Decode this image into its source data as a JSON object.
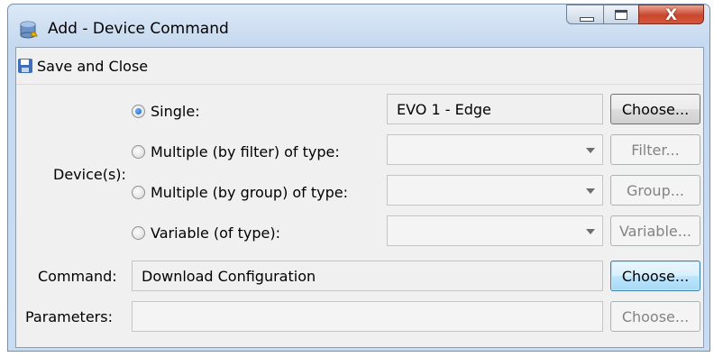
{
  "window": {
    "title": "Add - Device Command",
    "close_glyph": "X"
  },
  "toolbar": {
    "save_close_label": "Save and Close"
  },
  "devices": {
    "label": "Device(s):",
    "single": {
      "label": "Single:",
      "value": "EVO 1 - Edge",
      "button": "Choose..."
    },
    "filter": {
      "label": "Multiple (by filter) of type:",
      "value": "",
      "button": "Filter..."
    },
    "group": {
      "label": "Multiple (by group) of type:",
      "value": "",
      "button": "Group..."
    },
    "variable": {
      "label": "Variable (of type):",
      "value": "",
      "button": "Variable..."
    },
    "selected": "single"
  },
  "command": {
    "label": "Command:",
    "value": "Download Configuration",
    "button": "Choose..."
  },
  "parameters": {
    "label": "Parameters:",
    "value": "",
    "button": "Choose..."
  },
  "colors": {
    "focus_button": "#bee6fd",
    "title_bar": "#c6d9ef",
    "close_button": "#c9462d"
  },
  "icons": {
    "app": "database-icon",
    "save": "floppy-disk-icon"
  }
}
